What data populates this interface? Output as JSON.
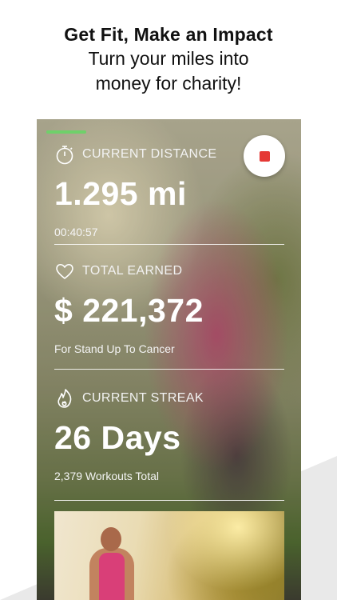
{
  "headline": {
    "title": "Get Fit, Make an Impact",
    "subtitle_line1": "Turn your miles into",
    "subtitle_line2": "money for charity!"
  },
  "stats": {
    "distance": {
      "label": "CURRENT DISTANCE",
      "value": "1.295 mi",
      "sub": "00:40:57",
      "icon": "stopwatch-icon"
    },
    "earned": {
      "label": "TOTAL EARNED",
      "value": "$ 221,372",
      "sub": "For Stand Up To Cancer",
      "icon": "heart-icon"
    },
    "streak": {
      "label": "CURRENT STREAK",
      "value": "26 Days",
      "sub": "2,379 Workouts Total",
      "icon": "flame-icon"
    }
  },
  "record_button": {
    "icon": "stop-icon",
    "color": "#e53935"
  },
  "colors": {
    "accent": "#6fd06a",
    "stop": "#e53935",
    "text_on_photo": "#ffffff"
  }
}
